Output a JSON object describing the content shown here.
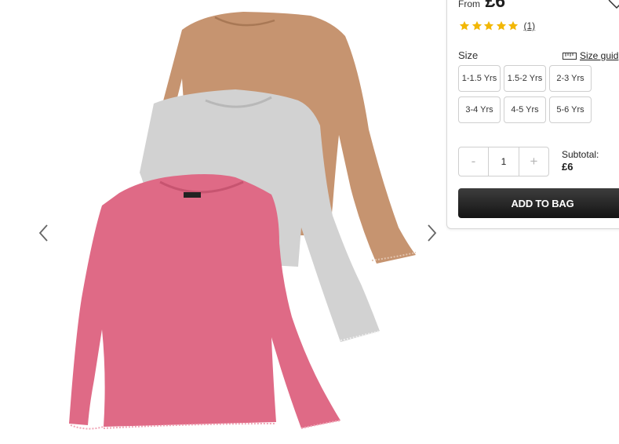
{
  "price": {
    "prefix": "From",
    "value": "£6"
  },
  "rating": {
    "stars": 5,
    "review_count": "(1)",
    "color": "#f2b705"
  },
  "size": {
    "label": "Size",
    "guide_label": "Size guid",
    "options": [
      "1-1.5 Yrs",
      "1.5-2 Yrs",
      "2-3 Yrs",
      "3-4 Yrs",
      "4-5 Yrs",
      "5-6 Yrs"
    ]
  },
  "quantity": {
    "minus": "-",
    "value": "1",
    "plus": "+"
  },
  "subtotal": {
    "label": "Subtotal:",
    "value": "£6"
  },
  "add_to_bag": "ADD TO BAG",
  "product_image": {
    "tops": [
      "brown-ribbed-top",
      "grey-marl-top",
      "pink-ribbed-top"
    ],
    "label_text": "George"
  },
  "colors": {
    "brown": "#c69470",
    "grey": "#d4d4d4",
    "pink": "#df6a86",
    "button": "#1e1e1e"
  },
  "icons": [
    "chevron-left-icon",
    "chevron-right-icon",
    "heart-icon",
    "star-icon",
    "ruler-icon"
  ]
}
